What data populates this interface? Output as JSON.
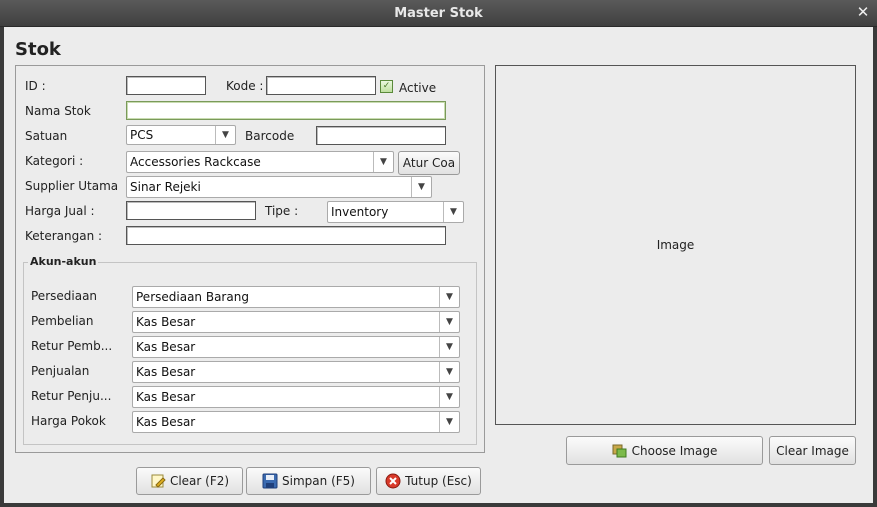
{
  "window": {
    "title": "Master Stok"
  },
  "heading": "Stok",
  "form": {
    "id_label": "ID :",
    "id_value": "",
    "kode_label": "Kode :",
    "kode_value": "",
    "active_label": "Active",
    "active_checked": true,
    "nama_label": "Nama Stok",
    "nama_value": "",
    "satuan_label": "Satuan",
    "satuan_value": "PCS",
    "barcode_label": "Barcode",
    "barcode_value": "",
    "kategori_label": "Kategori :",
    "kategori_value": "Accessories Rackcase",
    "atur_coa_label": "Atur Coa",
    "supplier_label": "Supplier Utama",
    "supplier_value": "Sinar Rejeki",
    "harga_label": "Harga Jual :",
    "harga_value": "",
    "tipe_label": "Tipe :",
    "tipe_value": "Inventory",
    "keterangan_label": "Keterangan :",
    "keterangan_value": ""
  },
  "akun": {
    "title": "Akun-akun",
    "rows": [
      {
        "label": "Persediaan",
        "value": "Persediaan Barang"
      },
      {
        "label": "Pembelian",
        "value": "Kas Besar"
      },
      {
        "label": "Retur Pemb...",
        "value": "Kas Besar"
      },
      {
        "label": "Penjualan",
        "value": "Kas Besar"
      },
      {
        "label": "Retur Penju...",
        "value": "Kas Besar"
      },
      {
        "label": "Harga Pokok",
        "value": "Kas Besar"
      }
    ]
  },
  "image": {
    "placeholder": "Image",
    "choose_label": "Choose Image",
    "clear_label": "Clear Image"
  },
  "actions": {
    "clear_label": "Clear (F2)",
    "simpan_label": "Simpan (F5)",
    "tutup_label": "Tutup (Esc)"
  }
}
